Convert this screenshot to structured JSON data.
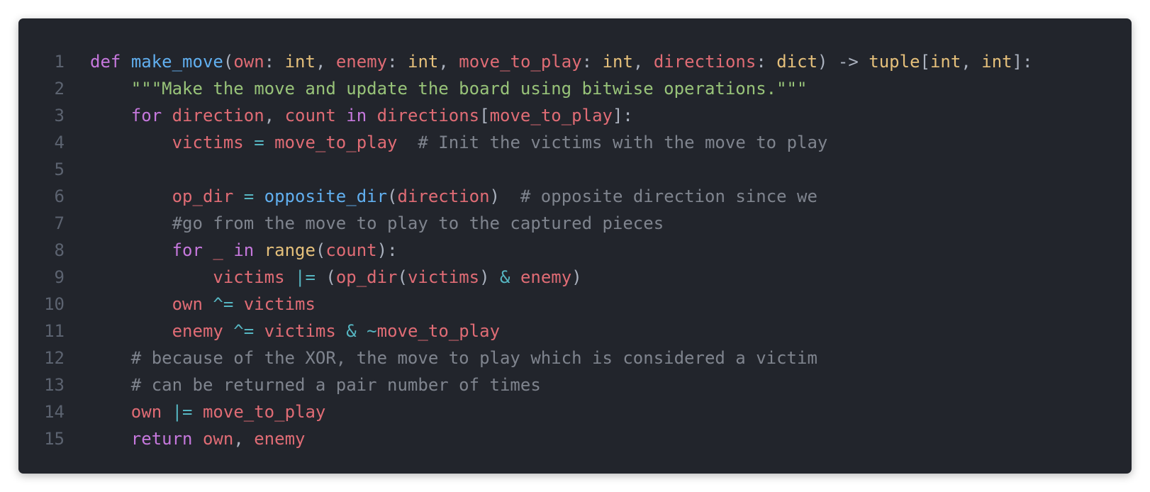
{
  "colors": {
    "background": "#22252c",
    "page": "#ffffff",
    "line_number": "#5c6370",
    "keyword": "#c678dd",
    "function": "#61afef",
    "variable": "#e06c75",
    "type": "#e5c07b",
    "string": "#98c379",
    "comment": "#7f848e",
    "operator": "#56b6c2",
    "punctuation": "#abb2bf"
  },
  "code": {
    "language": "python",
    "lines": [
      {
        "number": "1",
        "tokens": [
          {
            "t": "def",
            "c": "kw"
          },
          {
            "t": " ",
            "c": "pn"
          },
          {
            "t": "make_move",
            "c": "fn"
          },
          {
            "t": "(",
            "c": "pn"
          },
          {
            "t": "own",
            "c": "var"
          },
          {
            "t": ": ",
            "c": "pn"
          },
          {
            "t": "int",
            "c": "ty"
          },
          {
            "t": ", ",
            "c": "pn"
          },
          {
            "t": "enemy",
            "c": "var"
          },
          {
            "t": ": ",
            "c": "pn"
          },
          {
            "t": "int",
            "c": "ty"
          },
          {
            "t": ", ",
            "c": "pn"
          },
          {
            "t": "move_to_play",
            "c": "var"
          },
          {
            "t": ": ",
            "c": "pn"
          },
          {
            "t": "int",
            "c": "ty"
          },
          {
            "t": ", ",
            "c": "pn"
          },
          {
            "t": "directions",
            "c": "var"
          },
          {
            "t": ": ",
            "c": "pn"
          },
          {
            "t": "dict",
            "c": "ty"
          },
          {
            "t": ") -> ",
            "c": "pn"
          },
          {
            "t": "tuple",
            "c": "ty"
          },
          {
            "t": "[",
            "c": "pn"
          },
          {
            "t": "int",
            "c": "ty"
          },
          {
            "t": ", ",
            "c": "pn"
          },
          {
            "t": "int",
            "c": "ty"
          },
          {
            "t": "]:",
            "c": "pn"
          }
        ]
      },
      {
        "number": "2",
        "tokens": [
          {
            "t": "    ",
            "c": "pn"
          },
          {
            "t": "\"\"\"Make the move and update the board using bitwise operations.\"\"\"",
            "c": "str"
          }
        ]
      },
      {
        "number": "3",
        "tokens": [
          {
            "t": "    ",
            "c": "pn"
          },
          {
            "t": "for",
            "c": "kw"
          },
          {
            "t": " ",
            "c": "pn"
          },
          {
            "t": "direction",
            "c": "var"
          },
          {
            "t": ", ",
            "c": "pn"
          },
          {
            "t": "count",
            "c": "var"
          },
          {
            "t": " ",
            "c": "pn"
          },
          {
            "t": "in",
            "c": "kw"
          },
          {
            "t": " ",
            "c": "pn"
          },
          {
            "t": "directions",
            "c": "var"
          },
          {
            "t": "[",
            "c": "pn"
          },
          {
            "t": "move_to_play",
            "c": "var"
          },
          {
            "t": "]:",
            "c": "pn"
          }
        ]
      },
      {
        "number": "4",
        "tokens": [
          {
            "t": "        ",
            "c": "pn"
          },
          {
            "t": "victims",
            "c": "var"
          },
          {
            "t": " ",
            "c": "pn"
          },
          {
            "t": "=",
            "c": "op"
          },
          {
            "t": " ",
            "c": "pn"
          },
          {
            "t": "move_to_play",
            "c": "var"
          },
          {
            "t": "  ",
            "c": "pn"
          },
          {
            "t": "# Init the victims with the move to play",
            "c": "cm"
          }
        ]
      },
      {
        "number": "5",
        "tokens": []
      },
      {
        "number": "6",
        "tokens": [
          {
            "t": "        ",
            "c": "pn"
          },
          {
            "t": "op_dir",
            "c": "var"
          },
          {
            "t": " ",
            "c": "pn"
          },
          {
            "t": "=",
            "c": "op"
          },
          {
            "t": " ",
            "c": "pn"
          },
          {
            "t": "opposite_dir",
            "c": "fn"
          },
          {
            "t": "(",
            "c": "pn"
          },
          {
            "t": "direction",
            "c": "var"
          },
          {
            "t": ")  ",
            "c": "pn"
          },
          {
            "t": "# opposite direction since we",
            "c": "cm"
          }
        ]
      },
      {
        "number": "7",
        "tokens": [
          {
            "t": "        ",
            "c": "pn"
          },
          {
            "t": "#go from the move to play to the captured pieces",
            "c": "cm"
          }
        ]
      },
      {
        "number": "8",
        "tokens": [
          {
            "t": "        ",
            "c": "pn"
          },
          {
            "t": "for",
            "c": "kw"
          },
          {
            "t": " ",
            "c": "pn"
          },
          {
            "t": "_",
            "c": "var"
          },
          {
            "t": " ",
            "c": "pn"
          },
          {
            "t": "in",
            "c": "kw"
          },
          {
            "t": " ",
            "c": "pn"
          },
          {
            "t": "range",
            "c": "ty"
          },
          {
            "t": "(",
            "c": "pn"
          },
          {
            "t": "count",
            "c": "var"
          },
          {
            "t": "):",
            "c": "pn"
          }
        ]
      },
      {
        "number": "9",
        "tokens": [
          {
            "t": "            ",
            "c": "pn"
          },
          {
            "t": "victims",
            "c": "var"
          },
          {
            "t": " ",
            "c": "pn"
          },
          {
            "t": "|=",
            "c": "op"
          },
          {
            "t": " (",
            "c": "pn"
          },
          {
            "t": "op_dir",
            "c": "var"
          },
          {
            "t": "(",
            "c": "pn"
          },
          {
            "t": "victims",
            "c": "var"
          },
          {
            "t": ") ",
            "c": "pn"
          },
          {
            "t": "&",
            "c": "op"
          },
          {
            "t": " ",
            "c": "pn"
          },
          {
            "t": "enemy",
            "c": "var"
          },
          {
            "t": ")",
            "c": "pn"
          }
        ]
      },
      {
        "number": "10",
        "tokens": [
          {
            "t": "        ",
            "c": "pn"
          },
          {
            "t": "own",
            "c": "var"
          },
          {
            "t": " ",
            "c": "pn"
          },
          {
            "t": "^=",
            "c": "op"
          },
          {
            "t": " ",
            "c": "pn"
          },
          {
            "t": "victims",
            "c": "var"
          }
        ]
      },
      {
        "number": "11",
        "tokens": [
          {
            "t": "        ",
            "c": "pn"
          },
          {
            "t": "enemy",
            "c": "var"
          },
          {
            "t": " ",
            "c": "pn"
          },
          {
            "t": "^=",
            "c": "op"
          },
          {
            "t": " ",
            "c": "pn"
          },
          {
            "t": "victims",
            "c": "var"
          },
          {
            "t": " ",
            "c": "pn"
          },
          {
            "t": "&",
            "c": "op"
          },
          {
            "t": " ",
            "c": "pn"
          },
          {
            "t": "~",
            "c": "op"
          },
          {
            "t": "move_to_play",
            "c": "var"
          }
        ]
      },
      {
        "number": "12",
        "tokens": [
          {
            "t": "    ",
            "c": "pn"
          },
          {
            "t": "# because of the XOR, the move to play which is considered a victim",
            "c": "cm"
          }
        ]
      },
      {
        "number": "13",
        "tokens": [
          {
            "t": "    ",
            "c": "pn"
          },
          {
            "t": "# can be returned a pair number of times",
            "c": "cm"
          }
        ]
      },
      {
        "number": "14",
        "tokens": [
          {
            "t": "    ",
            "c": "pn"
          },
          {
            "t": "own",
            "c": "var"
          },
          {
            "t": " ",
            "c": "pn"
          },
          {
            "t": "|=",
            "c": "op"
          },
          {
            "t": " ",
            "c": "pn"
          },
          {
            "t": "move_to_play",
            "c": "var"
          }
        ]
      },
      {
        "number": "15",
        "tokens": [
          {
            "t": "    ",
            "c": "pn"
          },
          {
            "t": "return",
            "c": "kw"
          },
          {
            "t": " ",
            "c": "pn"
          },
          {
            "t": "own",
            "c": "var"
          },
          {
            "t": ", ",
            "c": "pn"
          },
          {
            "t": "enemy",
            "c": "var"
          }
        ]
      }
    ]
  }
}
